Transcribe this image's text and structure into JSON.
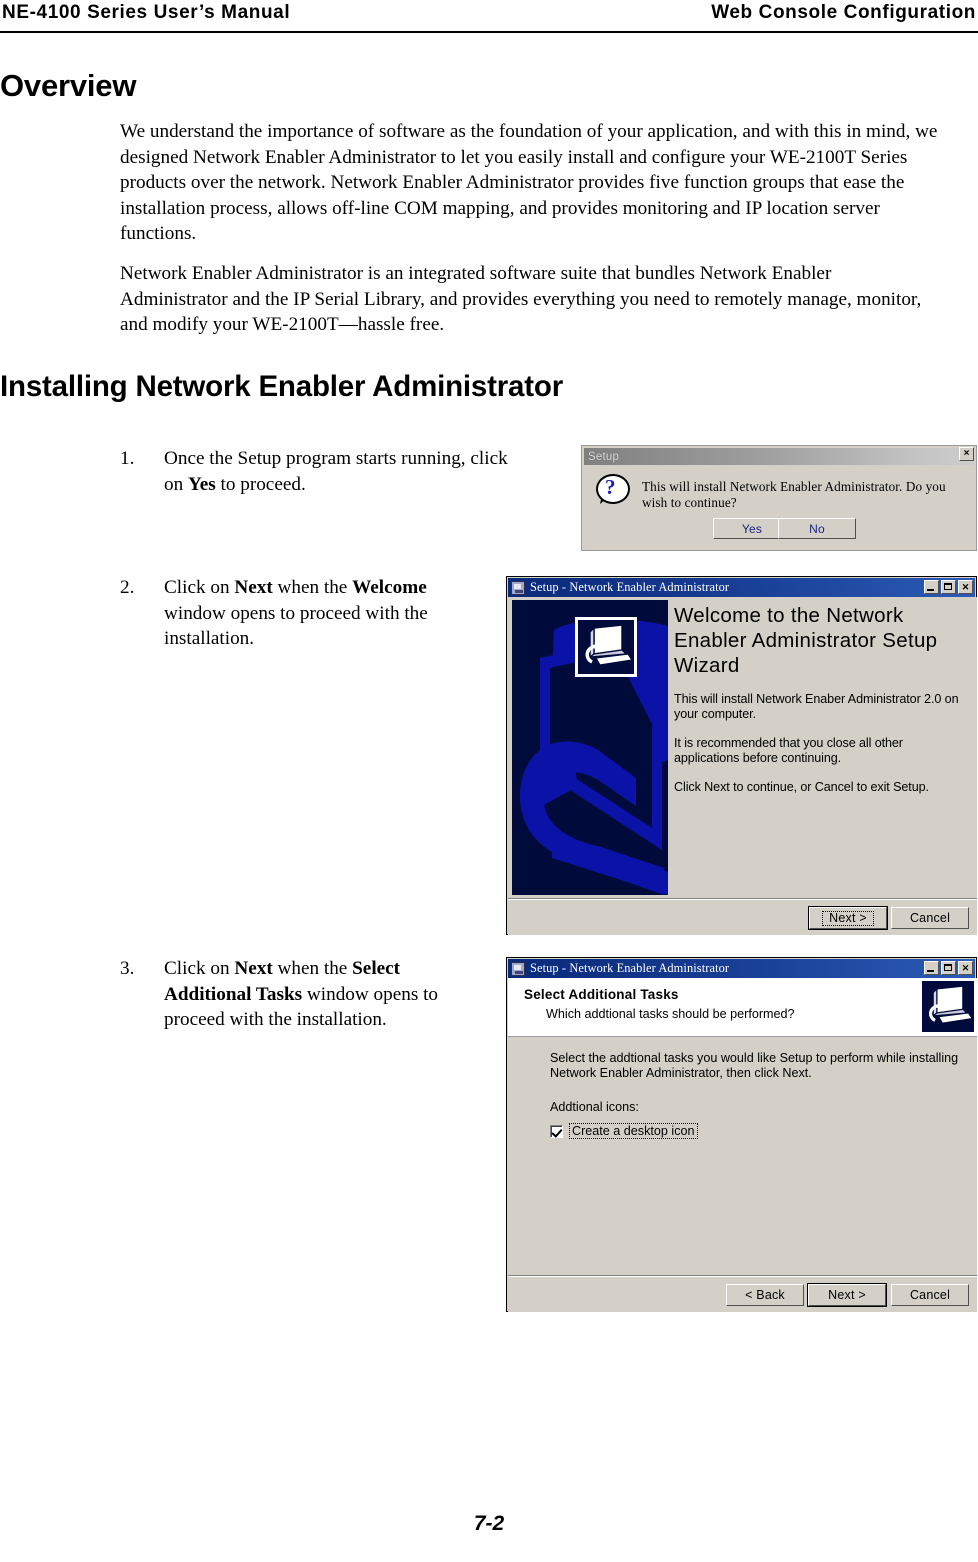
{
  "header": {
    "left": "NE-4100  Series  User’s  Manual",
    "right": "Web  Console  Configuration"
  },
  "headings": {
    "overview": "Overview",
    "installing": "Installing Network Enabler Administrator"
  },
  "paragraphs": {
    "p1": "We understand the importance of software as the foundation of your application, and with this in mind, we designed Network Enabler Administrator to let you easily install and configure your WE-2100T Series products over the network. Network Enabler Administrator provides five function groups that ease the installation process, allows off-line COM mapping, and provides monitoring and IP location server functions.",
    "p2": "Network Enabler Administrator is an integrated software suite that bundles Network Enabler Administrator and the IP Serial Library, and provides everything you need to remotely manage, monitor, and modify your WE-2100T—hassle free."
  },
  "steps": [
    {
      "number": "1.",
      "text_before": "Once the Setup program starts running, click on ",
      "bold1": "Yes",
      "text_after": " to proceed."
    },
    {
      "number": "2.",
      "text_before": "Click on ",
      "bold1": "Next",
      "text_mid": " when the ",
      "bold2": "Welcome",
      "text_after": " window opens to proceed with the installation."
    },
    {
      "number": "3.",
      "text_before": "Click on ",
      "bold1": "Next",
      "text_mid": " when the ",
      "bold2": "Select Additional Tasks",
      "text_after": " window opens to proceed with the installation."
    }
  ],
  "footer": {
    "page_number": "7-2"
  },
  "dialog_setup": {
    "title": "Setup",
    "close_label": "×",
    "message": "This will install Network Enabler Administrator. Do you wish to continue?",
    "icon": "question-mark-icon",
    "question_glyph": "?",
    "buttons": {
      "yes": "Yes",
      "no": "No"
    }
  },
  "dialog_welcome": {
    "title": "Setup - Network Enabler Administrator",
    "window_buttons": {
      "minimize": "_",
      "maximize": "□",
      "close": "✕"
    },
    "heading": "Welcome to the Network Enabler Administrator Setup Wizard",
    "paragraph1": "This will install Network Enaber Administrator 2.0 on your computer.",
    "paragraph2": "It is recommended that you close all other applications before continuing.",
    "paragraph3": "Click Next to continue, or Cancel to exit Setup.",
    "buttons": {
      "next": "Next >",
      "cancel": "Cancel"
    }
  },
  "dialog_tasks": {
    "title": "Setup - Network Enabler Administrator",
    "window_buttons": {
      "minimize": "_",
      "maximize": "□",
      "close": "✕"
    },
    "header_title": "Select Additional Tasks",
    "header_subtitle": "Which addtional tasks should be performed?",
    "body_text": "Select the addtional tasks you would like Setup to perform while installing Network Enabler Administrator, then click Next.",
    "icons_label": "Addtional icons:",
    "checkbox": {
      "label": "Create a desktop icon",
      "checked": true
    },
    "buttons": {
      "back": "< Back",
      "next": "Next >",
      "cancel": "Cancel"
    }
  },
  "colors": {
    "dialog_face": "#d4d0c8",
    "wizard_titlebar": "#0a2a7a",
    "banner_navy": "#000b3b",
    "banner_blue": "#0b12a8",
    "question_mark": "#1b1bbd",
    "button_text_blue": "#202080"
  }
}
